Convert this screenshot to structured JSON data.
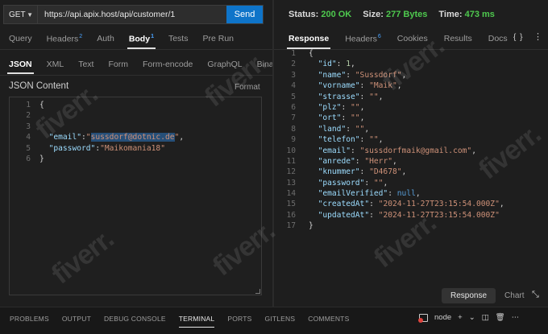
{
  "request": {
    "method": "GET",
    "url": "https://api.apix.host/api/customer/1",
    "send_label": "Send",
    "tabs": [
      {
        "label": "Query",
        "badge": ""
      },
      {
        "label": "Headers",
        "badge": "2"
      },
      {
        "label": "Auth",
        "badge": ""
      },
      {
        "label": "Body",
        "badge": "1"
      },
      {
        "label": "Tests",
        "badge": ""
      },
      {
        "label": "Pre Run",
        "badge": ""
      }
    ],
    "body_tabs": [
      "JSON",
      "XML",
      "Text",
      "Form",
      "Form-encode",
      "GraphQL",
      "Binary"
    ],
    "section_title": "JSON Content",
    "format_label": "Format",
    "body_lines": [
      [
        {
          "t": "{",
          "c": "punc"
        }
      ],
      [],
      [],
      [
        {
          "t": "  ",
          "c": "punc"
        },
        {
          "t": "\"email\"",
          "c": "key"
        },
        {
          "t": ":",
          "c": "punc"
        },
        {
          "t": "\"",
          "c": "str"
        },
        {
          "t": "sussdorf@dotnic.de",
          "c": "str hl"
        },
        {
          "t": "\"",
          "c": "str"
        },
        {
          "t": ",",
          "c": "punc"
        }
      ],
      [
        {
          "t": "  ",
          "c": "punc"
        },
        {
          "t": "\"password\"",
          "c": "key"
        },
        {
          "t": ":",
          "c": "punc"
        },
        {
          "t": "\"Maikomania18\"",
          "c": "str"
        }
      ],
      [
        {
          "t": "}",
          "c": "punc"
        }
      ]
    ]
  },
  "response": {
    "status_label": "Status:",
    "status_value": "200 OK",
    "size_label": "Size:",
    "size_value": "277 Bytes",
    "time_label": "Time:",
    "time_value": "473 ms",
    "tabs": [
      {
        "label": "Response",
        "badge": ""
      },
      {
        "label": "Headers",
        "badge": "6"
      },
      {
        "label": "Cookies",
        "badge": ""
      },
      {
        "label": "Results",
        "badge": ""
      },
      {
        "label": "Docs",
        "badge": ""
      }
    ],
    "braces_icon": "{ }",
    "more_icon": "⋮",
    "body_lines": [
      [
        {
          "t": "{",
          "c": "punc"
        }
      ],
      [
        {
          "t": "  ",
          "c": "punc"
        },
        {
          "t": "\"id\"",
          "c": "key"
        },
        {
          "t": ": ",
          "c": "punc"
        },
        {
          "t": "1",
          "c": "num"
        },
        {
          "t": ",",
          "c": "punc"
        }
      ],
      [
        {
          "t": "  ",
          "c": "punc"
        },
        {
          "t": "\"name\"",
          "c": "key"
        },
        {
          "t": ": ",
          "c": "punc"
        },
        {
          "t": "\"Sussdorf\"",
          "c": "str"
        },
        {
          "t": ",",
          "c": "punc"
        }
      ],
      [
        {
          "t": "  ",
          "c": "punc"
        },
        {
          "t": "\"vorname\"",
          "c": "key"
        },
        {
          "t": ": ",
          "c": "punc"
        },
        {
          "t": "\"Maik\"",
          "c": "str"
        },
        {
          "t": ",",
          "c": "punc"
        }
      ],
      [
        {
          "t": "  ",
          "c": "punc"
        },
        {
          "t": "\"strasse\"",
          "c": "key"
        },
        {
          "t": ": ",
          "c": "punc"
        },
        {
          "t": "\"\"",
          "c": "str"
        },
        {
          "t": ",",
          "c": "punc"
        }
      ],
      [
        {
          "t": "  ",
          "c": "punc"
        },
        {
          "t": "\"plz\"",
          "c": "key"
        },
        {
          "t": ": ",
          "c": "punc"
        },
        {
          "t": "\"\"",
          "c": "str"
        },
        {
          "t": ",",
          "c": "punc"
        }
      ],
      [
        {
          "t": "  ",
          "c": "punc"
        },
        {
          "t": "\"ort\"",
          "c": "key"
        },
        {
          "t": ": ",
          "c": "punc"
        },
        {
          "t": "\"\"",
          "c": "str"
        },
        {
          "t": ",",
          "c": "punc"
        }
      ],
      [
        {
          "t": "  ",
          "c": "punc"
        },
        {
          "t": "\"land\"",
          "c": "key"
        },
        {
          "t": ": ",
          "c": "punc"
        },
        {
          "t": "\"\"",
          "c": "str"
        },
        {
          "t": ",",
          "c": "punc"
        }
      ],
      [
        {
          "t": "  ",
          "c": "punc"
        },
        {
          "t": "\"telefon\"",
          "c": "key"
        },
        {
          "t": ": ",
          "c": "punc"
        },
        {
          "t": "\"\"",
          "c": "str"
        },
        {
          "t": ",",
          "c": "punc"
        }
      ],
      [
        {
          "t": "  ",
          "c": "punc"
        },
        {
          "t": "\"email\"",
          "c": "key"
        },
        {
          "t": ": ",
          "c": "punc"
        },
        {
          "t": "\"sussdorfmaik@gmail.com\"",
          "c": "str"
        },
        {
          "t": ",",
          "c": "punc"
        }
      ],
      [
        {
          "t": "  ",
          "c": "punc"
        },
        {
          "t": "\"anrede\"",
          "c": "key"
        },
        {
          "t": ": ",
          "c": "punc"
        },
        {
          "t": "\"Herr\"",
          "c": "str"
        },
        {
          "t": ",",
          "c": "punc"
        }
      ],
      [
        {
          "t": "  ",
          "c": "punc"
        },
        {
          "t": "\"knummer\"",
          "c": "key"
        },
        {
          "t": ": ",
          "c": "punc"
        },
        {
          "t": "\"D4678\"",
          "c": "str"
        },
        {
          "t": ",",
          "c": "punc"
        }
      ],
      [
        {
          "t": "  ",
          "c": "punc"
        },
        {
          "t": "\"password\"",
          "c": "key"
        },
        {
          "t": ": ",
          "c": "punc"
        },
        {
          "t": "\"\"",
          "c": "str"
        },
        {
          "t": ",",
          "c": "punc"
        }
      ],
      [
        {
          "t": "  ",
          "c": "punc"
        },
        {
          "t": "\"emailVerified\"",
          "c": "key"
        },
        {
          "t": ": ",
          "c": "punc"
        },
        {
          "t": "null",
          "c": "kw"
        },
        {
          "t": ",",
          "c": "punc"
        }
      ],
      [
        {
          "t": "  ",
          "c": "punc"
        },
        {
          "t": "\"createdAt\"",
          "c": "key"
        },
        {
          "t": ": ",
          "c": "punc"
        },
        {
          "t": "\"2024-11-27T23:15:54.000Z\"",
          "c": "str"
        },
        {
          "t": ",",
          "c": "punc"
        }
      ],
      [
        {
          "t": "  ",
          "c": "punc"
        },
        {
          "t": "\"updatedAt\"",
          "c": "key"
        },
        {
          "t": ": ",
          "c": "punc"
        },
        {
          "t": "\"2024-11-27T23:15:54.000Z\"",
          "c": "str"
        }
      ],
      [
        {
          "t": "}",
          "c": "punc"
        }
      ]
    ],
    "view_options": [
      "Response",
      "Chart"
    ],
    "expand_icon": "⤡"
  },
  "panel": {
    "tabs": [
      "PROBLEMS",
      "OUTPUT",
      "DEBUG CONSOLE",
      "TERMINAL",
      "PORTS",
      "GITLENS",
      "COMMENTS"
    ],
    "active_tab": "TERMINAL",
    "terminal_name": "node",
    "add_icon": "+",
    "caret_icon": "⌄",
    "split_icon": "◫",
    "trash_icon": "🗑",
    "more_icon": "⋯"
  },
  "watermark": "fiverr."
}
